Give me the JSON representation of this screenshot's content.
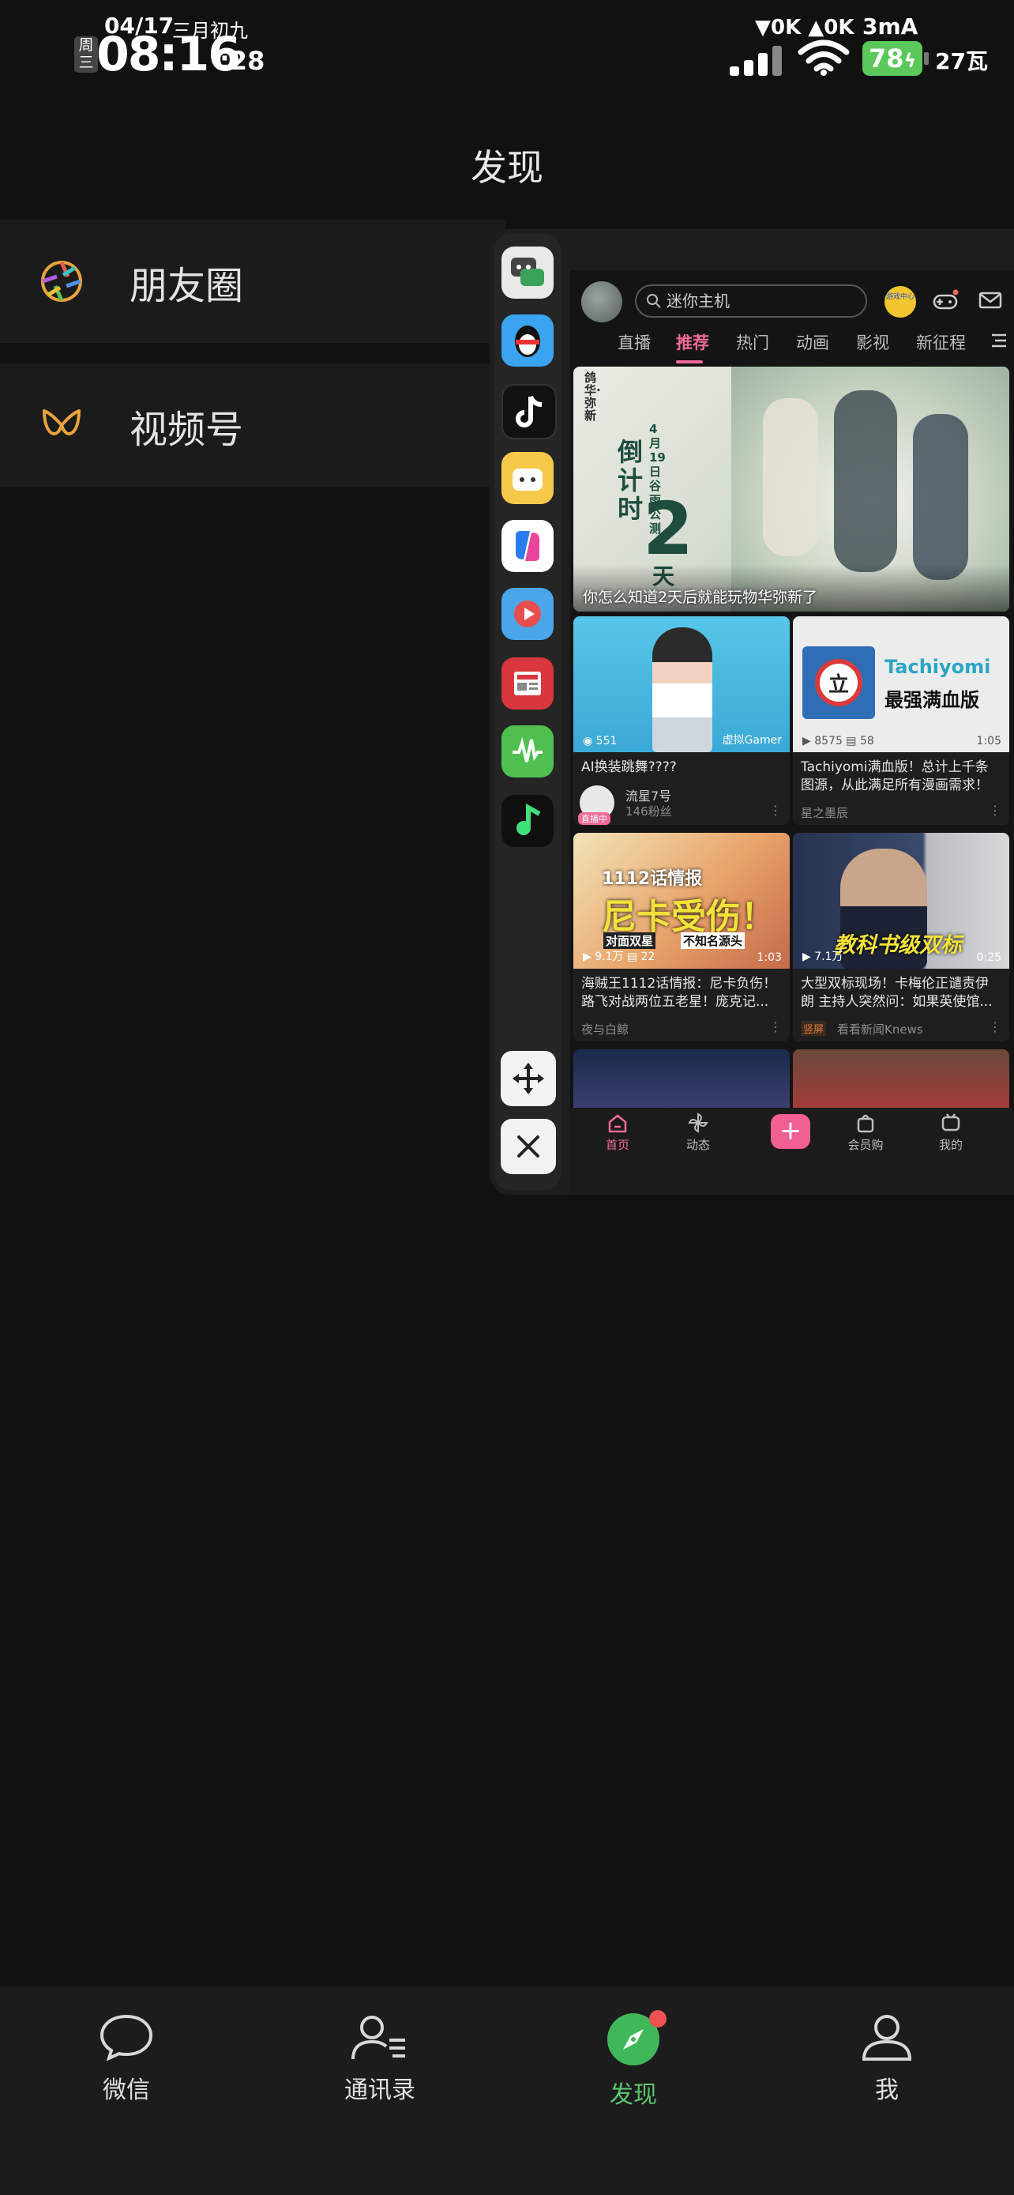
{
  "status_bar": {
    "date": "04/17",
    "lunar": "三月初九",
    "weekday": "周三",
    "time": "08:16",
    "seconds": ":28",
    "net_speed": "▼0K ▲0K",
    "current": "3mA",
    "battery": "78",
    "power": "27瓦"
  },
  "page": {
    "title": "发现"
  },
  "menu": {
    "moments": "朋友圈",
    "channels": "视频号"
  },
  "dock": {
    "apps": [
      "chat-app-icon",
      "qq-icon",
      "tiktok-icon",
      "bilibili-icon",
      "copilot-icon",
      "video-player-icon",
      "news-icon",
      "audio-wave-icon",
      "music-icon"
    ],
    "move_label": "move-icon",
    "close_label": "close-icon"
  },
  "bilibili": {
    "search_placeholder": "迷你主机",
    "game_badge": "游戏中心",
    "tabs": [
      "直播",
      "推荐",
      "热门",
      "动画",
      "影视",
      "新征程"
    ],
    "active_tab": "推荐",
    "banner": {
      "line1": "倒计时",
      "number": "2",
      "line2": "天",
      "side": "4月19日 谷雨公测",
      "logo": "鸽华·弥新",
      "caption": "你怎么知道2天后就能玩物华弥新了"
    },
    "cards": [
      {
        "views": "551",
        "channel": "虚拟Gamer",
        "duration": "",
        "title": "AI换装跳舞????",
        "author": "流星7号",
        "extra": "146粉丝",
        "live_tag": "直播中",
        "thumb_text": ""
      },
      {
        "views": "8575",
        "danmaku": "58",
        "duration": "1:05",
        "title": "Tachiyomi满血版！总计上千条图源，从此满足所有漫画需求！",
        "author": "星之墨辰",
        "thumb_text": "最强满血版",
        "thumb_brand": "Tachiyomi",
        "thumb_glyph": "立"
      },
      {
        "views": "9.1万",
        "danmaku": "22",
        "duration": "1:03",
        "title": "海贼王1112话情报：尼卡负伤！路飞对战两位五老星！庞克记...",
        "author": "夜与白鲸",
        "thumb_text": "尼卡受伤！",
        "thumb_top": "1112话情报",
        "thumb_tag1": "对面双星",
        "thumb_tag2": "不知名源头"
      },
      {
        "views": "7.1万",
        "danmaku": "",
        "duration": "0:25",
        "title": "大型双标现场！卡梅伦正谴责伊朗 主持人突然问：如果英使馆...",
        "author": "看看新闻Knews",
        "author_tag": "竖屏",
        "thumb_text": "教科书级双标"
      }
    ],
    "bottom_nav": [
      "首页",
      "动态",
      "+",
      "会员购",
      "我的"
    ]
  },
  "tabbar": {
    "items": [
      "微信",
      "通讯录",
      "发现",
      "我"
    ],
    "active": "发现"
  }
}
